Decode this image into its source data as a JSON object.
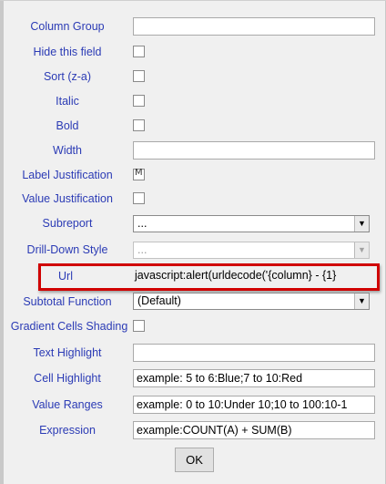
{
  "fields": {
    "column_group": {
      "label": "Column Group",
      "value": ""
    },
    "hide_field": {
      "label": "Hide this field"
    },
    "sort": {
      "label": "Sort (z-a)"
    },
    "italic": {
      "label": "Italic"
    },
    "bold": {
      "label": "Bold"
    },
    "width": {
      "label": "Width",
      "value": ""
    },
    "label_justification": {
      "label": "Label Justification"
    },
    "value_justification": {
      "label": "Value Justification"
    },
    "subreport": {
      "label": "Subreport",
      "value": "..."
    },
    "drill_down": {
      "label": "Drill-Down Style",
      "value": "..."
    },
    "url": {
      "label": "Url",
      "value": "javascript:alert(urldecode('{column} - {1}"
    },
    "subtotal": {
      "label": "Subtotal Function",
      "value": "(Default)"
    },
    "gradient": {
      "label": "Gradient Cells Shading"
    },
    "text_highlight": {
      "label": "Text Highlight",
      "value": ""
    },
    "cell_highlight": {
      "label": "Cell Highlight",
      "value": "example: 5 to 6:Blue;7 to 10:Red"
    },
    "value_ranges": {
      "label": "Value Ranges",
      "value": "example: 0 to 10:Under 10;10 to 100:10-1"
    },
    "expression": {
      "label": "Expression",
      "value": "example:COUNT(A) + SUM(B)"
    }
  },
  "ok_label": "OK",
  "colors": {
    "label": "#2b3bb5",
    "highlight": "#d00000"
  }
}
